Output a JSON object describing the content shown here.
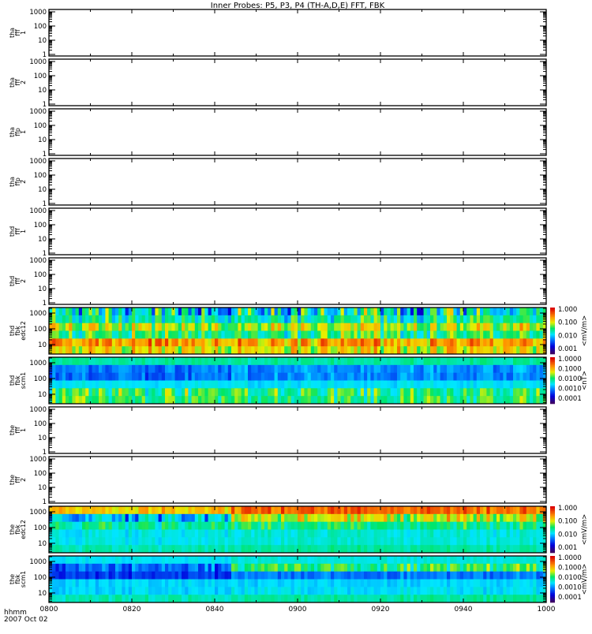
{
  "title": "Inner Probes: P5, P3, P4 (TH-A,D,E) FFT, FBK",
  "x_axis": {
    "ticks": [
      "0800",
      "0820",
      "0840",
      "0900",
      "0920",
      "0940",
      "1000"
    ],
    "label_line1": "hhmm",
    "label_line2": "2007 Oct 02"
  },
  "chart_data": {
    "type": "heatmap",
    "title": "Inner Probes: P5, P3, P4 (TH-A,D,E) FFT, FBK",
    "xlabel": "hhmm 2007 Oct 02",
    "xlim": [
      "0800",
      "1000"
    ],
    "panels": [
      {
        "label": [
          "tha",
          "fff",
          "1"
        ],
        "yticks": [
          "1",
          "10",
          "100",
          "1000"
        ],
        "ylim": [
          1,
          1000
        ],
        "empty": true
      },
      {
        "label": [
          "tha",
          "fff",
          "2"
        ],
        "yticks": [
          "1",
          "10",
          "100",
          "1000"
        ],
        "ylim": [
          1,
          1000
        ],
        "empty": true
      },
      {
        "label": [
          "tha",
          "ffp",
          "1"
        ],
        "yticks": [
          "1",
          "10",
          "100",
          "1000"
        ],
        "ylim": [
          1,
          1000
        ],
        "empty": true
      },
      {
        "label": [
          "tha",
          "ffp",
          "2"
        ],
        "yticks": [
          "1",
          "10",
          "100",
          "1000"
        ],
        "ylim": [
          1,
          1000
        ],
        "empty": true
      },
      {
        "label": [
          "thd",
          "fff",
          "1"
        ],
        "yticks": [
          "1",
          "10",
          "100",
          "1000"
        ],
        "ylim": [
          1,
          1000
        ],
        "empty": true
      },
      {
        "label": [
          "thd",
          "fff",
          "2"
        ],
        "yticks": [
          "1",
          "10",
          "100",
          "1000"
        ],
        "ylim": [
          1,
          1000
        ],
        "empty": true
      },
      {
        "label": [
          "thd",
          "fbk",
          "edc12"
        ],
        "yticks": [
          "10",
          "100",
          "1000"
        ],
        "ylim": [
          2.5,
          2240
        ],
        "empty": false,
        "colorbar": {
          "ticks": [
            "1.000",
            "0.100",
            "0.010",
            "0.001"
          ],
          "unit": "<mV/m>"
        },
        "bands": [
          {
            "level": 0.45,
            "late": 0.45,
            "spread": 0.35
          },
          {
            "level": 0.5,
            "late": 0.5,
            "spread": 0.2
          },
          {
            "level": 0.66,
            "late": 0.66,
            "spread": 0.2
          },
          {
            "level": 0.55,
            "late": 0.55,
            "spread": 0.2
          },
          {
            "level": 0.8,
            "late": 0.78,
            "spread": 0.18
          },
          {
            "level": 0.7,
            "late": 0.7,
            "spread": 0.18
          }
        ]
      },
      {
        "label": [
          "thd",
          "fbk",
          "scm1"
        ],
        "yticks": [
          "10",
          "100",
          "1000"
        ],
        "ylim": [
          2.5,
          2240
        ],
        "empty": false,
        "colorbar": {
          "ticks": [
            "1.0000",
            "0.1000",
            "0.0100",
            "0.0010",
            "0.0001"
          ],
          "unit": "<nT>"
        },
        "bands": [
          {
            "level": 0.5,
            "late": 0.5,
            "spread": 0.05
          },
          {
            "level": 0.3,
            "late": 0.33,
            "spread": 0.1
          },
          {
            "level": 0.28,
            "late": 0.32,
            "spread": 0.1
          },
          {
            "level": 0.42,
            "late": 0.42,
            "spread": 0.05
          },
          {
            "level": 0.55,
            "late": 0.55,
            "spread": 0.18
          },
          {
            "level": 0.55,
            "late": 0.55,
            "spread": 0.15
          }
        ]
      },
      {
        "label": [
          "the",
          "fff",
          "1"
        ],
        "yticks": [
          "1",
          "10",
          "100",
          "1000"
        ],
        "ylim": [
          1,
          1000
        ],
        "empty": true
      },
      {
        "label": [
          "the",
          "fff",
          "2"
        ],
        "yticks": [
          "1",
          "10",
          "100",
          "1000"
        ],
        "ylim": [
          1,
          1000
        ],
        "empty": true
      },
      {
        "label": [
          "the",
          "fbk",
          "edc12"
        ],
        "yticks": [
          "10",
          "100",
          "1000"
        ],
        "ylim": [
          2.5,
          2240
        ],
        "empty": false,
        "colorbar": {
          "ticks": [
            "1.000",
            "0.100",
            "0.010",
            "0.001"
          ],
          "unit": "<mV/m>"
        },
        "bands": [
          {
            "level": 0.72,
            "late": 0.85,
            "spread": 0.12
          },
          {
            "level": 0.35,
            "late": 0.66,
            "spread": 0.2
          },
          {
            "level": 0.5,
            "late": 0.52,
            "spread": 0.12
          },
          {
            "level": 0.43,
            "late": 0.45,
            "spread": 0.06
          },
          {
            "level": 0.43,
            "late": 0.45,
            "spread": 0.05
          },
          {
            "level": 0.48,
            "late": 0.5,
            "spread": 0.05
          }
        ]
      },
      {
        "label": [
          "the",
          "fbk",
          "scm1"
        ],
        "yticks": [
          "10",
          "100",
          "1000"
        ],
        "ylim": [
          2.5,
          2240
        ],
        "empty": false,
        "colorbar": {
          "ticks": [
            "1.0000",
            "0.1000",
            "0.0100",
            "0.0010",
            "0.0001"
          ],
          "unit": "<mV/m>"
        },
        "bands": [
          {
            "level": 0.42,
            "late": 0.45,
            "spread": 0.04
          },
          {
            "level": 0.28,
            "late": 0.55,
            "spread": 0.15
          },
          {
            "level": 0.22,
            "late": 0.3,
            "spread": 0.08
          },
          {
            "level": 0.4,
            "late": 0.4,
            "spread": 0.05
          },
          {
            "level": 0.4,
            "late": 0.42,
            "spread": 0.06
          },
          {
            "level": 0.48,
            "late": 0.5,
            "spread": 0.05
          }
        ]
      }
    ]
  }
}
